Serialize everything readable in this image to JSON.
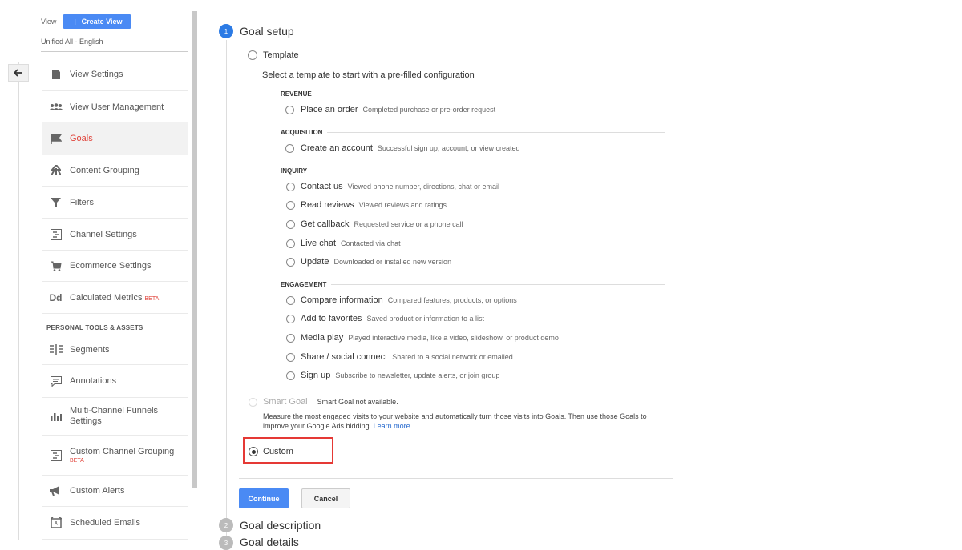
{
  "view": {
    "label": "View",
    "create_button": "Create View",
    "name": "Unified All - English"
  },
  "sidebar": {
    "items": [
      {
        "label": "View Settings",
        "icon": "document-icon"
      },
      {
        "label": "View User Management",
        "icon": "users-icon"
      },
      {
        "label": "Goals",
        "icon": "flag-icon"
      },
      {
        "label": "Content Grouping",
        "icon": "content-grouping-icon"
      },
      {
        "label": "Filters",
        "icon": "filter-icon"
      },
      {
        "label": "Channel Settings",
        "icon": "channel-icon"
      },
      {
        "label": "Ecommerce Settings",
        "icon": "cart-icon"
      },
      {
        "label": "Calculated Metrics",
        "icon": "dd-icon",
        "badge": "BETA"
      }
    ],
    "section_title": "PERSONAL TOOLS & ASSETS",
    "tools": [
      {
        "label": "Segments",
        "icon": "segments-icon"
      },
      {
        "label": "Annotations",
        "icon": "annotation-icon"
      },
      {
        "label": "Multi-Channel Funnels Settings",
        "icon": "bar-chart-icon"
      },
      {
        "label": "Custom Channel Grouping",
        "icon": "channel-grouping-icon",
        "badge": "BETA"
      },
      {
        "label": "Custom Alerts",
        "icon": "megaphone-icon"
      },
      {
        "label": "Scheduled Emails",
        "icon": "alarm-icon"
      }
    ]
  },
  "steps": [
    {
      "number": "1",
      "title": "Goal setup"
    },
    {
      "number": "2",
      "title": "Goal description"
    },
    {
      "number": "3",
      "title": "Goal details"
    }
  ],
  "goal_setup": {
    "template_label": "Template",
    "template_hint": "Select a template to start with a pre-filled configuration",
    "categories": [
      {
        "title": "REVENUE",
        "options": [
          {
            "label": "Place an order",
            "desc": "Completed purchase or pre-order request"
          }
        ]
      },
      {
        "title": "ACQUISITION",
        "options": [
          {
            "label": "Create an account",
            "desc": "Successful sign up, account, or view created"
          }
        ]
      },
      {
        "title": "INQUIRY",
        "options": [
          {
            "label": "Contact us",
            "desc": "Viewed phone number, directions, chat or email"
          },
          {
            "label": "Read reviews",
            "desc": "Viewed reviews and ratings"
          },
          {
            "label": "Get callback",
            "desc": "Requested service or a phone call"
          },
          {
            "label": "Live chat",
            "desc": "Contacted via chat"
          },
          {
            "label": "Update",
            "desc": "Downloaded or installed new version"
          }
        ]
      },
      {
        "title": "ENGAGEMENT",
        "options": [
          {
            "label": "Compare information",
            "desc": "Compared features, products, or options"
          },
          {
            "label": "Add to favorites",
            "desc": "Saved product or information to a list"
          },
          {
            "label": "Media play",
            "desc": "Played interactive media, like a video, slideshow, or product demo"
          },
          {
            "label": "Share / social connect",
            "desc": "Shared to a social network or emailed"
          },
          {
            "label": "Sign up",
            "desc": "Subscribe to newsletter, update alerts, or join group"
          }
        ]
      }
    ],
    "smart_goal_label": "Smart Goal",
    "smart_goal_status": "Smart Goal not available.",
    "smart_goal_desc_1": "Measure the most engaged visits to your website and automatically turn those visits into Goals. Then use those Goals to",
    "smart_goal_desc_2": "improve your Google Ads bidding.",
    "learn_more": "Learn more",
    "custom_label": "Custom"
  },
  "buttons": {
    "continue": "Continue",
    "cancel": "Cancel"
  },
  "colors": {
    "accent": "#4a8af4",
    "step_active": "#2c7be5",
    "active_nav": "#e0433a",
    "highlight": "#e53935"
  }
}
